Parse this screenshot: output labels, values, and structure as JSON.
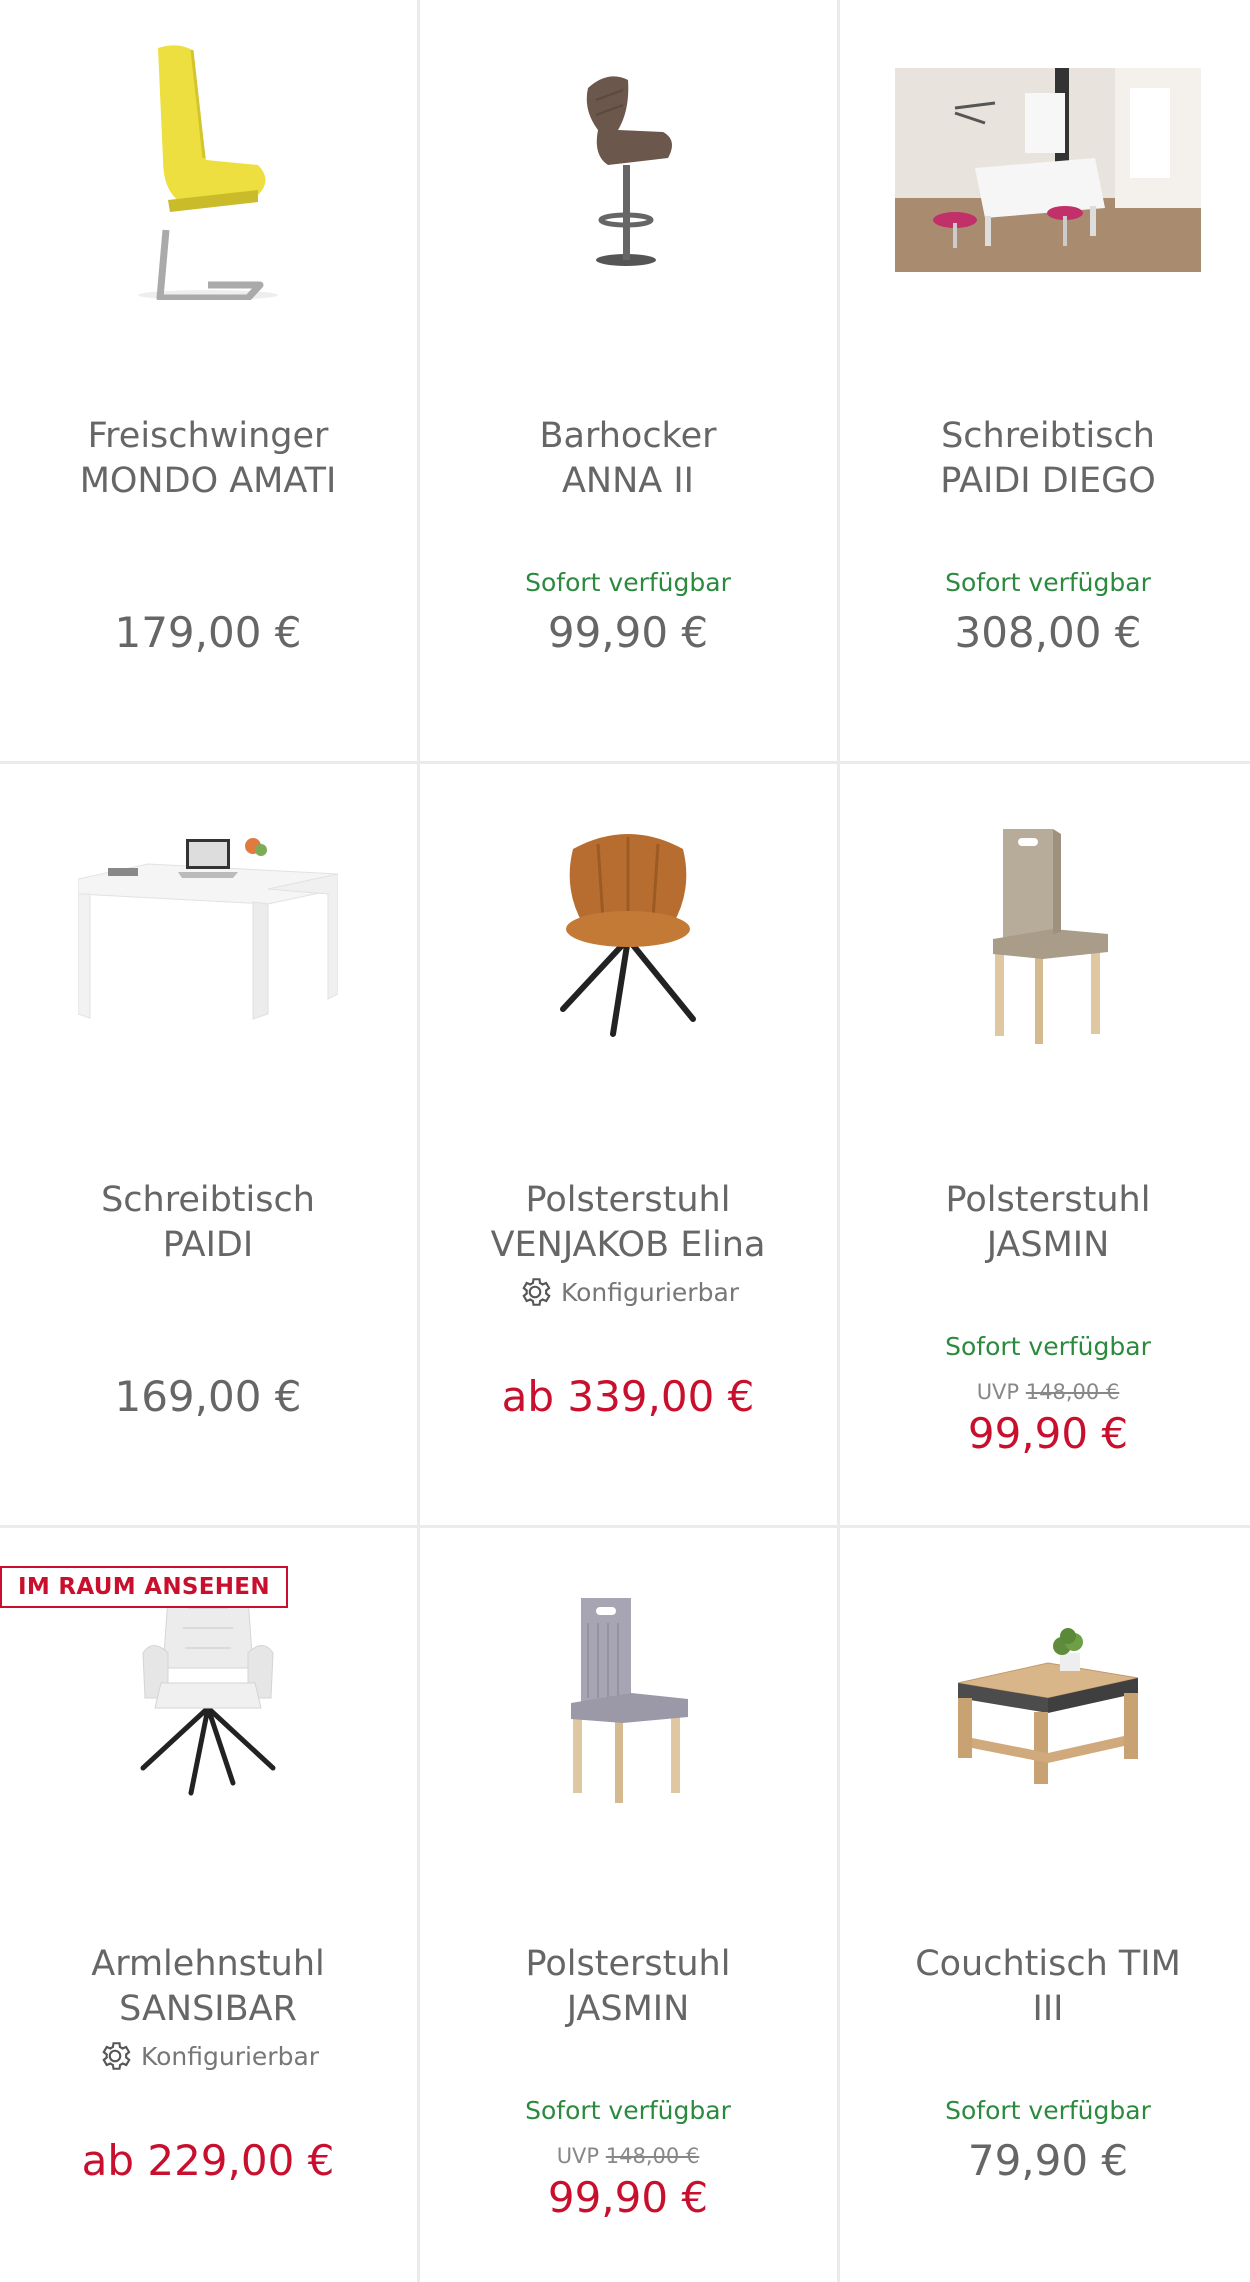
{
  "products": [
    {
      "name_line1": "Freischwinger",
      "name_line2": "MONDO AMATI",
      "availability": "",
      "uvp_label": "",
      "uvp_old": "",
      "price": "179,00 €",
      "image": "yellow-cantilever-chair"
    },
    {
      "name_line1": "Barhocker",
      "name_line2": "ANNA II",
      "availability": "Sofort verfügbar",
      "uvp_label": "",
      "uvp_old": "",
      "price": "99,90 €",
      "image": "brown-bar-stool"
    },
    {
      "name_line1": "Schreibtisch",
      "name_line2": "PAIDI DIEGO",
      "availability": "Sofort verfügbar",
      "uvp_label": "",
      "uvp_old": "",
      "price": "308,00 €",
      "image": "kids-room-desk-photo"
    },
    {
      "name_line1": "Schreibtisch",
      "name_line2": "PAIDI",
      "availability": "",
      "uvp_label": "",
      "uvp_old": "",
      "price": "169,00 €",
      "image": "white-desk"
    },
    {
      "name_line1": "Polsterstuhl",
      "name_line2": "VENJAKOB Elina",
      "config_label": "Konfigurierbar",
      "availability": "",
      "uvp_label": "",
      "uvp_old": "",
      "price": "ab 339,00 €",
      "image": "orange-shell-chair"
    },
    {
      "name_line1": "Polsterstuhl",
      "name_line2": "JASMIN",
      "availability": "Sofort verfügbar",
      "uvp_label": "UVP",
      "uvp_old": "148,00 €",
      "price": "99,90 €",
      "image": "beige-upholstered-chair"
    },
    {
      "name_line1": "Armlehnstuhl",
      "name_line2": "SANSIBAR",
      "config_label": "Konfigurierbar",
      "badge": "IM RAUM ANSEHEN",
      "availability": "",
      "uvp_label": "",
      "uvp_old": "",
      "price": "ab 229,00 €",
      "image": "white-armchair"
    },
    {
      "name_line1": "Polsterstuhl",
      "name_line2": "JASMIN",
      "availability": "Sofort verfügbar",
      "uvp_label": "UVP",
      "uvp_old": "148,00 €",
      "price": "99,90 €",
      "image": "grey-upholstered-chair"
    },
    {
      "name_line1": "Couchtisch TIM",
      "name_line2": "III",
      "availability": "Sofort verfügbar",
      "uvp_label": "",
      "uvp_old": "",
      "price": "79,90 €",
      "image": "wooden-coffee-table"
    }
  ],
  "colors": {
    "sale": "#c8102e",
    "available": "#2b8a3e",
    "text": "#666666",
    "divider": "#ebebeb"
  }
}
